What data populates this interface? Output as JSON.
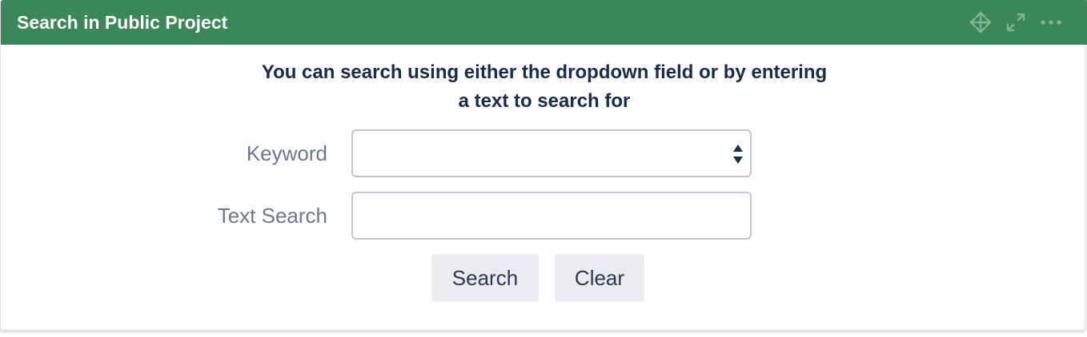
{
  "panel": {
    "title": "Search in Public Project",
    "header_color": "#3b875a",
    "actions": [
      {
        "name": "move",
        "icon": "move-icon"
      },
      {
        "name": "expand",
        "icon": "expand-icon"
      },
      {
        "name": "more",
        "icon": "more-icon"
      }
    ]
  },
  "form": {
    "intro_line1": "You can search using either the dropdown field or by entering",
    "intro_line2": "a text to search for",
    "keyword": {
      "label": "Keyword",
      "value": ""
    },
    "text_search": {
      "label": "Text Search",
      "value": "",
      "placeholder": ""
    },
    "search_button": "Search",
    "clear_button": "Clear"
  }
}
